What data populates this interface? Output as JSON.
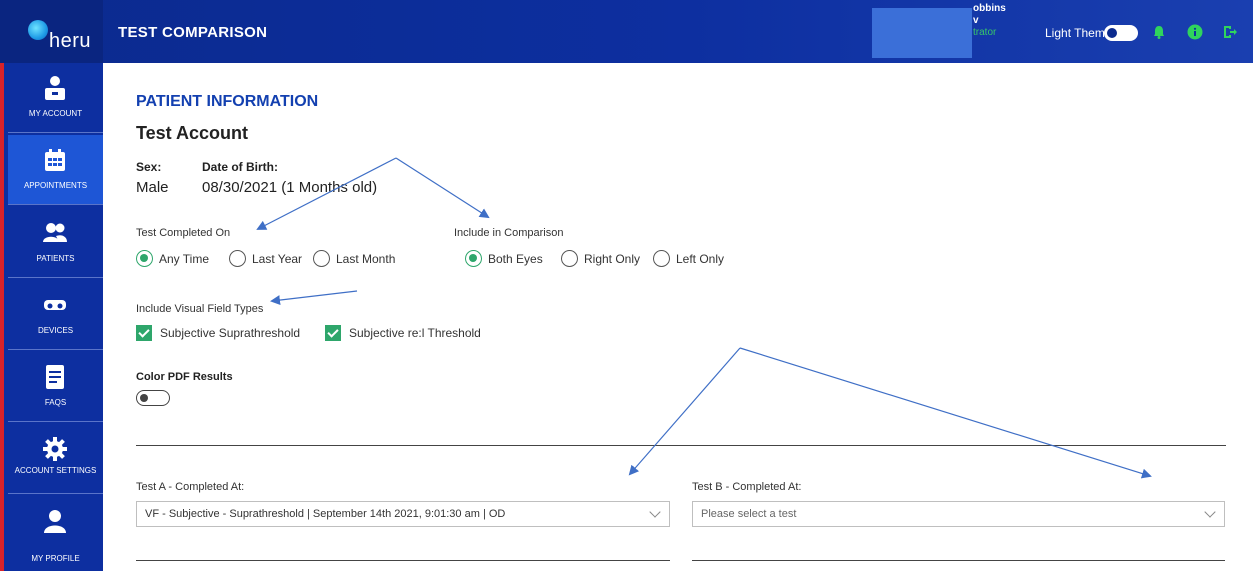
{
  "app": {
    "logo_text": "heru",
    "page_title": "TEST COMPARISON"
  },
  "header": {
    "user_line1": "obbins",
    "user_line2": "v",
    "user_line3": "trator",
    "theme_label": "Light Theme"
  },
  "sidebar": {
    "items": [
      {
        "label": "MY ACCOUNT"
      },
      {
        "label": "APPOINTMENTS"
      },
      {
        "label": "PATIENTS"
      },
      {
        "label": "DEVICES"
      },
      {
        "label": "FAQS"
      },
      {
        "label": "ACCOUNT SETTINGS"
      },
      {
        "label": "MY PROFILE"
      }
    ]
  },
  "patient": {
    "section_title": "PATIENT INFORMATION",
    "account_name": "Test Account",
    "sex_label": "Sex:",
    "sex_value": "Male",
    "dob_label": "Date of Birth:",
    "dob_value": "08/30/2021 (1 Months old)"
  },
  "filters": {
    "completed_on_label": "Test Completed On",
    "completed_on_options": [
      "Any Time",
      "Last Year",
      "Last Month"
    ],
    "completed_on_selected": "Any Time",
    "include_label": "Include in Comparison",
    "include_options": [
      "Both Eyes",
      "Right Only",
      "Left Only"
    ],
    "include_selected": "Both Eyes",
    "vf_types_label": "Include Visual Field Types",
    "vf_types": [
      {
        "label": "Subjective Suprathreshold",
        "checked": true
      },
      {
        "label": "Subjective re:l Threshold",
        "checked": true
      }
    ],
    "color_pdf_label": "Color PDF Results",
    "color_pdf_on": false
  },
  "comparison": {
    "test_a_label": "Test A - Completed At:",
    "test_a_value": "VF - Subjective - Suprathreshold | September 14th 2021, 9:01:30 am | OD",
    "test_b_label": "Test B - Completed At:",
    "test_b_placeholder": "Please select a test"
  },
  "colors": {
    "header_bg": "#0d2fa0",
    "active_nav": "#1e56d6",
    "accent_green": "#2ea66b",
    "title_blue": "#1340b0",
    "annotation_arrow": "#3f6fc6"
  }
}
